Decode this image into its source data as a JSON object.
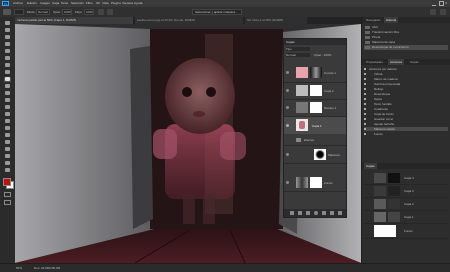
{
  "app": {
    "logo": "Ps"
  },
  "menu": [
    "Archivo",
    "Edición",
    "Imagen",
    "Capa",
    "Texto",
    "Selección",
    "Filtro",
    "3D",
    "Vista",
    "Plugins",
    "Ventana",
    "Ayuda"
  ],
  "options": {
    "mode_label": "Modo:",
    "mode_value": "Normal",
    "opacity_label": "Opac.:",
    "opacity_value": "100%",
    "flow_label": "Flujo:",
    "flow_value": "100%",
    "select_subject": "Seleccionar y aplicar máscara..."
  },
  "tabs": [
    "muñeca-pasillo.psd al 50% (Capa 1, RGB/8)",
    "pasillo-oscuro.jpg al 33,3% (Fondo, RGB/8)",
    "Sin título-1 al 25% (RGB/8)"
  ],
  "layers_panel": {
    "title": "Capas",
    "filter": "Tipo",
    "blend": "Normal",
    "opacity": "Opac.: 100%",
    "layers": [
      {
        "name": "Curvas 1",
        "type": "adjustment"
      },
      {
        "name": "Capa 2",
        "type": "mask"
      },
      {
        "name": "Niveles 1",
        "type": "adjustment"
      },
      {
        "name": "Capa 1",
        "type": "doll"
      },
      {
        "name": "Efectos",
        "type": "group"
      },
      {
        "name": "Máscara",
        "type": "mask-dark"
      },
      {
        "name": "Fondo",
        "type": "background"
      }
    ]
  },
  "right_panels": {
    "top_tabs": [
      "Navegador",
      "Historia"
    ],
    "history": [
      "Abrir",
      "Transformación libre",
      "Pincel",
      "Máscara de capa",
      "Desenfoque de movimiento"
    ],
    "mid_tabs": [
      "Propiedades",
      "Acciones",
      "Capas"
    ],
    "actions": [
      "Acciones por defecto",
      "Viñeta",
      "Marco de madera",
      "Sombra proyectada",
      "Reflejo",
      "Desenfoque",
      "Sepia",
      "Texto fundido",
      "Cuadrante",
      "Capa de fondo",
      "Guardar como",
      "Ajustar tamaño",
      "Máscara rápida",
      "Fondo"
    ],
    "layers2_tab": "Capas",
    "layers2": [
      "Capa 4",
      "Capa 3",
      "Capa 2",
      "Capa 1",
      "Fondo"
    ],
    "layers2_last_label": "Fondo"
  },
  "status": {
    "zoom": "50%",
    "doc": "Doc: 22,9M/105,6M"
  },
  "colors": {
    "accent": "#31a8ff",
    "foreground": "#c40f0f",
    "background": "#ffffff",
    "wall": "#8a8a8d",
    "floor": "#4a1d22"
  }
}
